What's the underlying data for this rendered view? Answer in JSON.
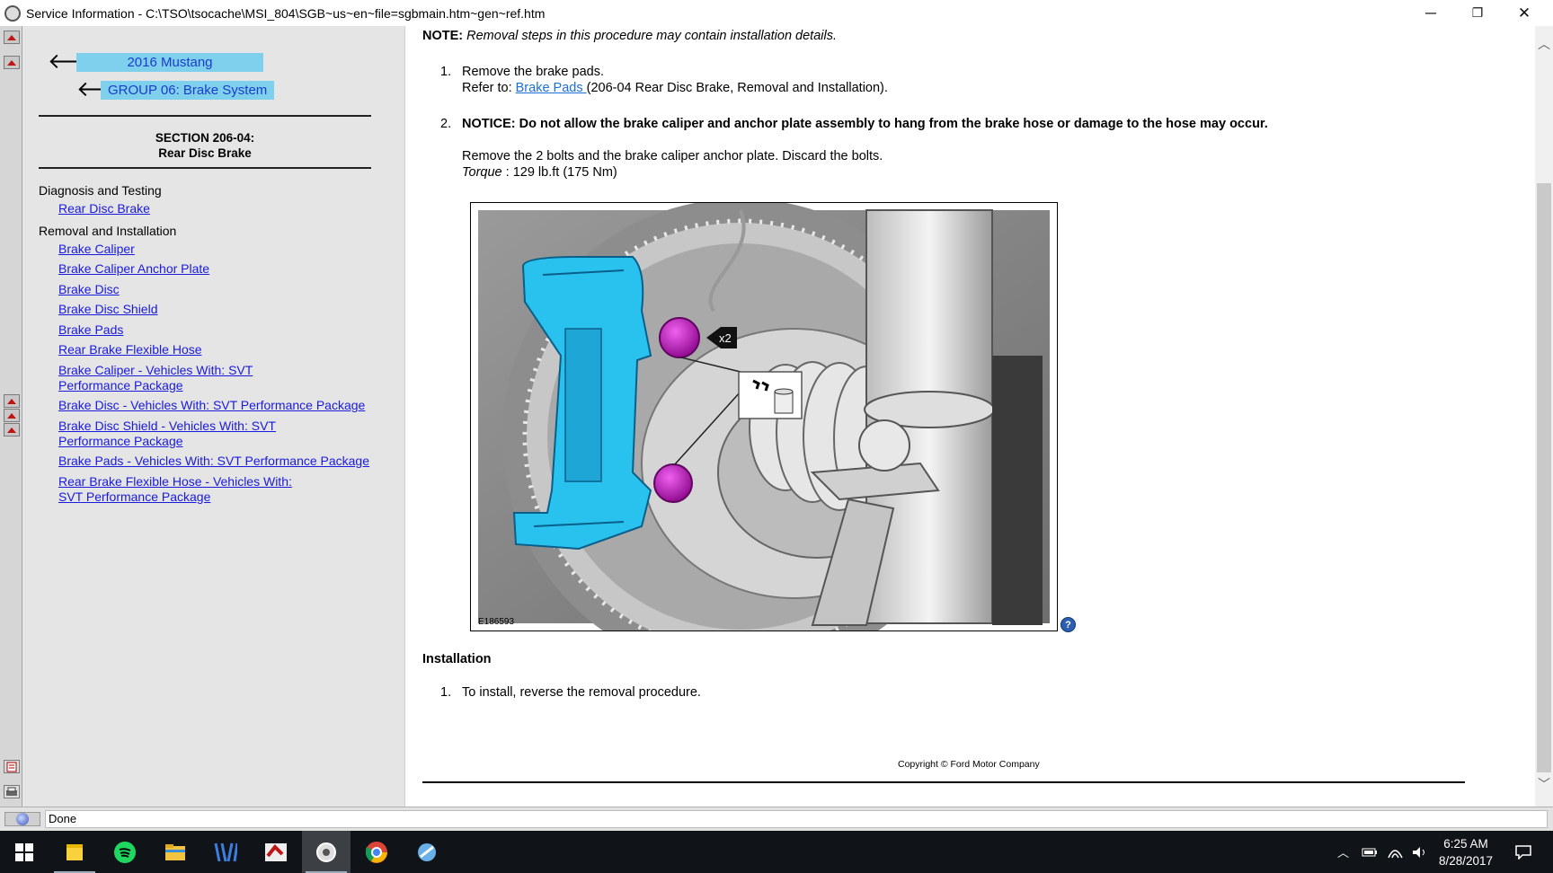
{
  "window": {
    "title": "Service Information - C:\\TSO\\tsocache\\MSI_804\\SGB~us~en~file=sgbmain.htm~gen~ref.htm",
    "minimize": "─",
    "restore": "❐",
    "close": "✕"
  },
  "sidebar": {
    "crumbs": [
      {
        "label": "2016 Mustang"
      },
      {
        "label": "GROUP 06: Brake System"
      }
    ],
    "section_line1": "SECTION 206-04:",
    "section_line2": "Rear Disc Brake",
    "groups": [
      {
        "heading": "Diagnosis and Testing",
        "links": [
          "Rear Disc Brake"
        ]
      },
      {
        "heading": "Removal and Installation",
        "links": [
          "Brake Caliper",
          "Brake Caliper Anchor Plate",
          "Brake Disc",
          "Brake Disc Shield",
          "Brake Pads",
          "Rear Brake Flexible Hose",
          "Brake Caliper - Vehicles With: SVT Performance Package",
          "Brake Disc - Vehicles With: SVT Performance Package",
          "Brake Disc Shield - Vehicles With: SVT Performance Package",
          "Brake Pads - Vehicles With: SVT Performance Package",
          "Rear Brake Flexible Hose - Vehicles With: SVT Performance Package"
        ]
      }
    ]
  },
  "main": {
    "note_label": "NOTE:",
    "note_text": "Removal steps in this procedure may contain installation details.",
    "step1": {
      "num": "1.",
      "line1": "Remove the brake pads.",
      "refer_label": "Refer to:",
      "link": "Brake Pads ",
      "ref_suffix": "(206-04 Rear Disc Brake, Removal and Installation)."
    },
    "step2": {
      "num": "2.",
      "notice": "NOTICE: Do not allow the brake caliper and anchor plate assembly to hang from the brake hose or damage to the hose may occur.",
      "line1": "Remove the 2 bolts and the brake caliper anchor plate. Discard the bolts.",
      "torque_label": "Torque",
      "torque_value": " : 129 lb.ft (175 Nm)"
    },
    "figure": {
      "id": "E186593",
      "callout": "x2",
      "help": "?"
    },
    "installation_heading": "Installation",
    "install_step": {
      "num": "1.",
      "text": "To install, reverse the removal procedure."
    },
    "copyright": "Copyright © Ford Motor Company"
  },
  "statusbar": {
    "text": "Done"
  },
  "taskbar": {
    "time": "6:25 AM",
    "date": "8/28/2017"
  }
}
